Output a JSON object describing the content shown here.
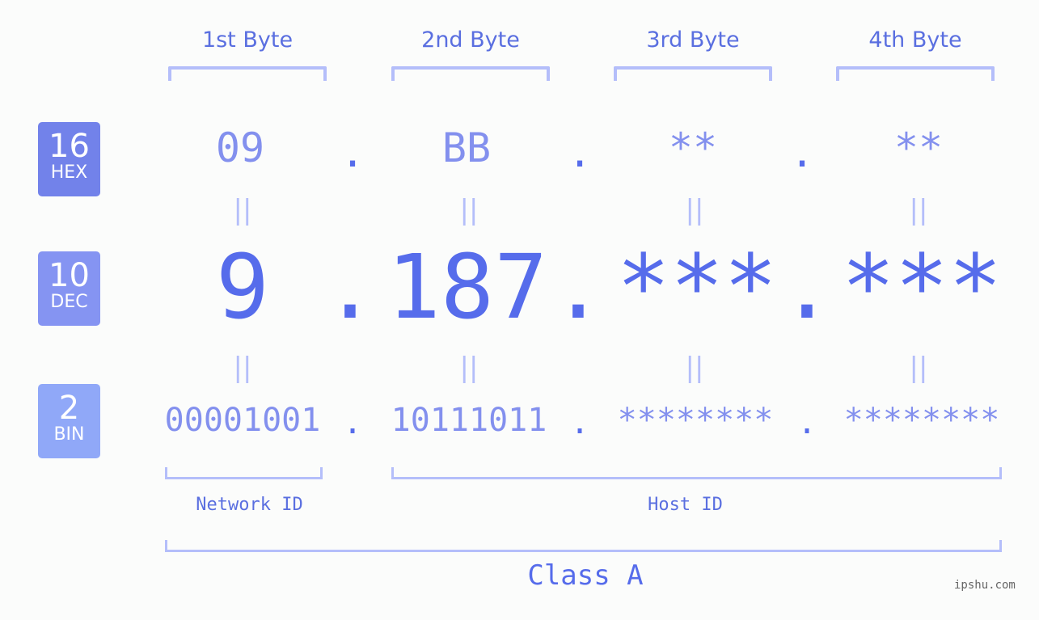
{
  "bytes": [
    {
      "header": "1st Byte",
      "hex": "09",
      "dec": "9",
      "bin": "00001001"
    },
    {
      "header": "2nd Byte",
      "hex": "BB",
      "dec": "187",
      "bin": "10111011"
    },
    {
      "header": "3rd Byte",
      "hex": "**",
      "dec": "***",
      "bin": "********"
    },
    {
      "header": "4th Byte",
      "hex": "**",
      "dec": "***",
      "bin": "********"
    }
  ],
  "separator": ".",
  "equals": "||",
  "badges": {
    "hex": {
      "num": "16",
      "label": "HEX",
      "color": "#7282ea"
    },
    "dec": {
      "num": "10",
      "label": "DEC",
      "color": "#8594f2"
    },
    "bin": {
      "num": "2",
      "label": "BIN",
      "color": "#90a8f8"
    }
  },
  "labels": {
    "network_id": "Network ID",
    "host_id": "Host ID",
    "class": "Class A"
  },
  "watermark": "ipshu.com",
  "colors": {
    "accent": "#566ceb",
    "light": "#8390ee",
    "bracket": "#b4befa"
  }
}
